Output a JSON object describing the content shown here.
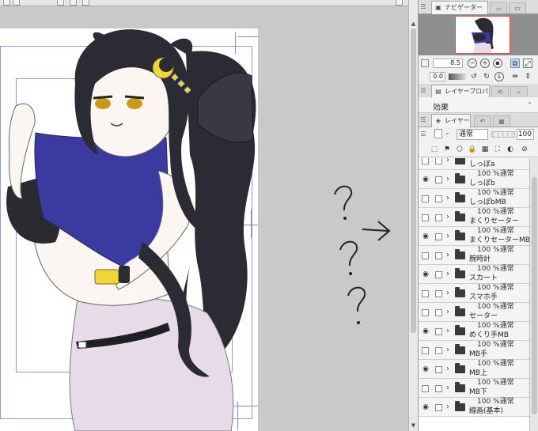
{
  "panels": {
    "navigator": {
      "tab_label": "ナビゲーター",
      "zoom": "8.5",
      "rotation": "0.0"
    },
    "layer_property": {
      "tab_label": "レイヤープロパ",
      "effect_label": "効果"
    },
    "layers": {
      "tab_label": "レイヤー",
      "blend_mode": "通常",
      "opacity": "100",
      "items": [
        {
          "meta": "100 %通常",
          "name": "しっぽa",
          "visible": false
        },
        {
          "meta": "100 %通常",
          "name": "しっぽb",
          "visible": true
        },
        {
          "meta": "100 %通常",
          "name": "しっぽbMB",
          "visible": false
        },
        {
          "meta": "100 %通常",
          "name": "まくりセーター",
          "visible": false
        },
        {
          "meta": "100 %通常",
          "name": "まくりセーターMB",
          "visible": true
        },
        {
          "meta": "100 %通常",
          "name": "腕時計",
          "visible": false
        },
        {
          "meta": "100 %通常",
          "name": "スカート",
          "visible": true
        },
        {
          "meta": "100 %通常",
          "name": "スマホ手",
          "visible": false
        },
        {
          "meta": "100 %通常",
          "name": "セーター",
          "visible": false
        },
        {
          "meta": "100 %通常",
          "name": "めくり手MB",
          "visible": true
        },
        {
          "meta": "100 %通常",
          "name": "MB手",
          "visible": false
        },
        {
          "meta": "100 %通常",
          "name": "MB上",
          "visible": true
        },
        {
          "meta": "100 %通常",
          "name": "MB下",
          "visible": false
        },
        {
          "meta": "100 %通常",
          "name": "線画(基本)",
          "visible": true
        }
      ]
    }
  },
  "annotation": {
    "text": "? → ? ?"
  },
  "icons": {
    "eye": "eye-icon",
    "folder": "folder-icon",
    "expand": "chevron-right-icon"
  },
  "colors": {
    "sweater": "#3a3aa0",
    "hair": "#2b2b33",
    "skirt": "#e7dbea",
    "accent_gold": "#f0d63a"
  }
}
